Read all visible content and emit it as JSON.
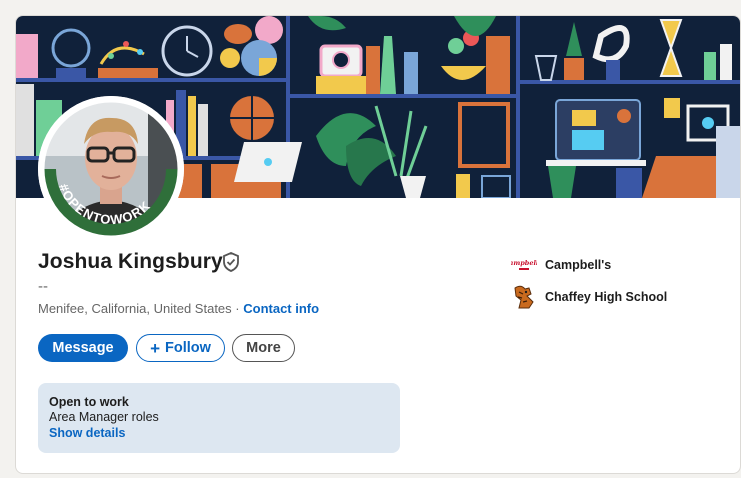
{
  "profile": {
    "name": "Joshua Kingsbury",
    "headline": "--",
    "location": "Menifee, California, United States",
    "separator": "·",
    "contact_label": "Contact info",
    "avatar_frame_text": "#OPENTOWORK"
  },
  "actions": {
    "message_label": "Message",
    "follow_label": "Follow",
    "follow_icon": "+",
    "more_label": "More"
  },
  "open_to_work": {
    "title": "Open to work",
    "roles": "Area Manager roles",
    "details_link": "Show details"
  },
  "experience": [
    {
      "name": "Campbell's",
      "logo_text": "Campbell's"
    },
    {
      "name": "Chaffey High School"
    }
  ],
  "colors": {
    "brand_blue": "#0a66c2",
    "open_to_work_green": "#2f6f3a",
    "banner_navy": "#10213a"
  }
}
